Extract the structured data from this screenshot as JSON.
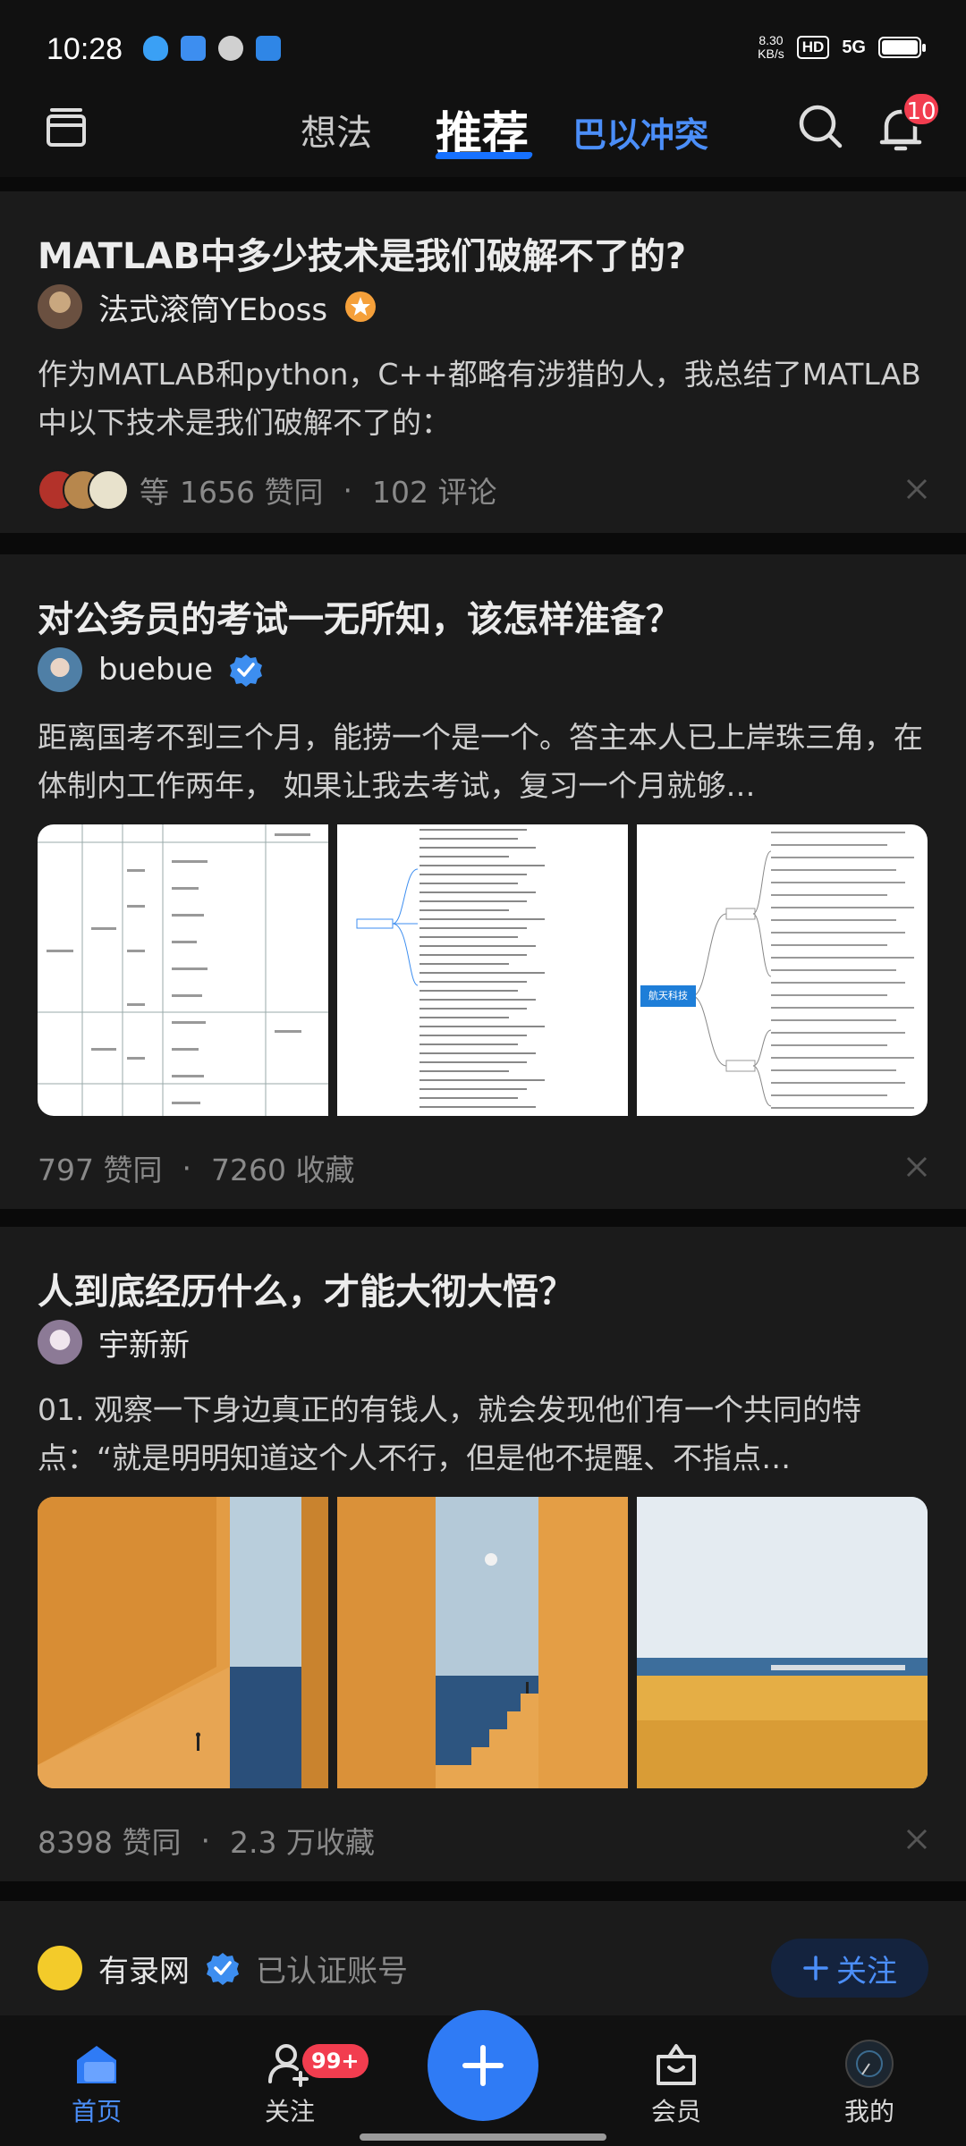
{
  "status_bar": {
    "time": "10:28",
    "speed_value": "8.30",
    "speed_unit": "KB/s",
    "hd": "HD",
    "network": "5G",
    "battery_level": 0.9
  },
  "header": {
    "tabs": [
      {
        "label": "想法"
      },
      {
        "label": "推荐"
      },
      {
        "label": "巴以冲突"
      }
    ],
    "notification_count": "10"
  },
  "feed": [
    {
      "title": "MATLAB中多少技术是我们破解不了的?",
      "author": "法式滚筒YEboss",
      "excerpt": "作为MATLAB和python，C++都略有涉猎的人，我总结了MATLAB中以下技术是我们破解不了的：",
      "stats": {
        "prefix": "等",
        "likes": "1656 赞同",
        "comments": "102 评论"
      }
    },
    {
      "title": "对公务员的考试一无所知，该怎样准备？",
      "author": "buebue",
      "excerpt": "距离国考不到三个月，能捞一个是一个。答主本人已上岸珠三角，在体制内工作两年， 如果让我去考试，复习一个月就够…",
      "stats": {
        "likes": "797 赞同",
        "favorites": "7260 收藏"
      },
      "image_center_label": "航天科技"
    },
    {
      "title": "人到底经历什么，才能大彻大悟？",
      "author": "宇新新",
      "excerpt": "01. 观察一下身边真正的有钱人，就会发现他们有一个共同的特点：“就是明明知道这个人不行，但是他不提醒、不指点…",
      "stats": {
        "likes": "8398 赞同",
        "favorites": "2.3 万收藏"
      }
    },
    {
      "author": "有录网",
      "verified_text": "已认证账号",
      "follow_label": "关注"
    }
  ],
  "bottom_nav": {
    "items": [
      {
        "label": "首页"
      },
      {
        "label": "关注"
      },
      {
        "label": "会员"
      },
      {
        "label": "我的"
      }
    ],
    "follow_badge": "99+"
  },
  "colors": {
    "accent": "#1771ff",
    "link": "#4b8ef8",
    "badge": "#f23d4f",
    "card_bg": "#1b1b1b",
    "page_bg": "#0a0a0a"
  }
}
